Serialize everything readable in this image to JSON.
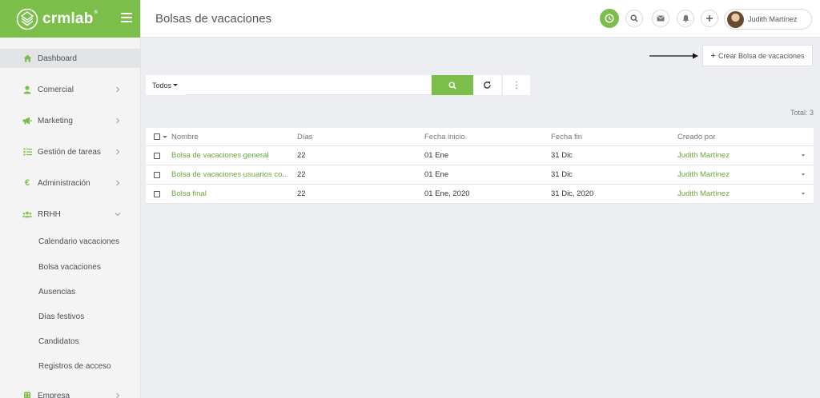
{
  "brand": {
    "name": "crmlab",
    "mark": "®"
  },
  "header": {
    "title": "Bolsas de vacaciones",
    "user_name": "Judith Martínez"
  },
  "sidebar": {
    "items": [
      {
        "label": "Dashboard",
        "icon": "home-icon"
      },
      {
        "label": "Comercial",
        "icon": "user-icon"
      },
      {
        "label": "Marketing",
        "icon": "megaphone-icon"
      },
      {
        "label": "Gestión de tareas",
        "icon": "tasks-icon"
      },
      {
        "label": "Administración",
        "icon": "euro-icon"
      },
      {
        "label": "RRHH",
        "icon": "users-icon"
      },
      {
        "label": "Empresa",
        "icon": "building-icon"
      }
    ],
    "subitems": [
      {
        "label": "Calendario vacaciones"
      },
      {
        "label": "Bolsa vacaciones"
      },
      {
        "label": "Ausencias"
      },
      {
        "label": "Días festivos"
      },
      {
        "label": "Candidatos"
      },
      {
        "label": "Registros de acceso"
      }
    ]
  },
  "toolbar": {
    "create_label": "Crear Bolsa de vacaciones",
    "create_plus": "+",
    "filter_label": "Todos",
    "search_placeholder": "",
    "total_label": "Total: 3"
  },
  "table": {
    "columns": [
      "Nombre",
      "Días",
      "Fecha inicio",
      "Fecha fin",
      "Creado por"
    ],
    "rows": [
      {
        "nombre": "Bolsa de vacaciones general",
        "dias": "22",
        "inicio": "01 Ene",
        "fin": "31 Dic",
        "creado": "Judith Martínez"
      },
      {
        "nombre": "Bolsa de vacaciones usuarios co...",
        "dias": "22",
        "inicio": "01 Ene",
        "fin": "31 Dic",
        "creado": "Judith Martínez"
      },
      {
        "nombre": "Bolsa final",
        "dias": "22",
        "inicio": "01 Ene, 2020",
        "fin": "31 Dic, 2020",
        "creado": "Judith Martínez"
      }
    ]
  },
  "colors": {
    "accent": "#7bbf4a",
    "link": "#6aa83b",
    "sidebar_bg": "#f4f4f5",
    "content_bg": "#eceef1"
  }
}
